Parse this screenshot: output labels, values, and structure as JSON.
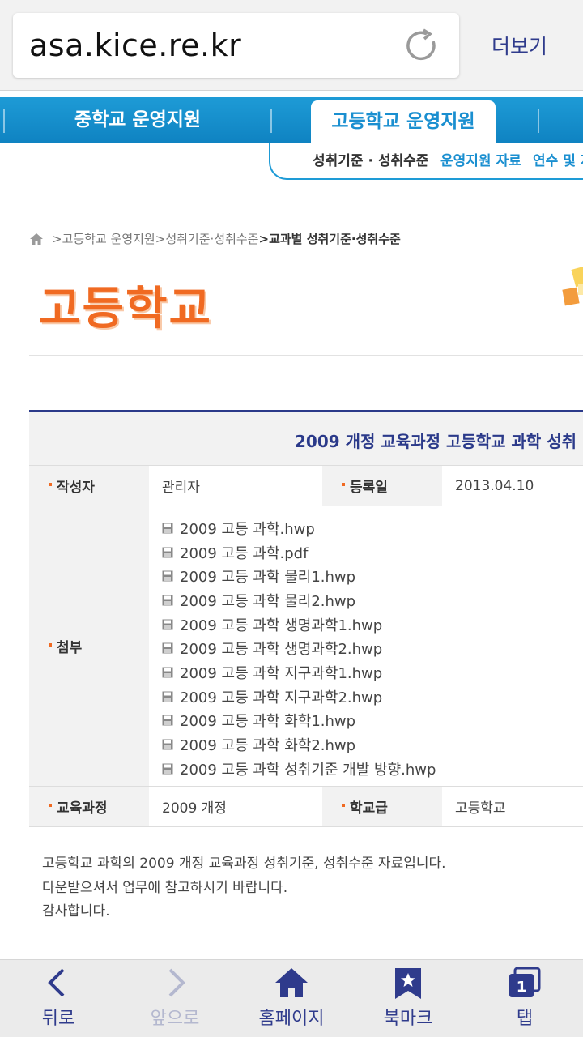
{
  "browser": {
    "url": "asa.kice.re.kr",
    "more_label": "더보기",
    "bottom_nav": {
      "back": "뒤로",
      "forward": "앞으로",
      "home": "홈페이지",
      "bookmark": "북마크",
      "tabs": "탭",
      "tab_count": "1"
    }
  },
  "site_nav": {
    "tabs": [
      "중학교 운영지원",
      "고등학교 운영지원"
    ],
    "active_tab": "고등학교 운영지원",
    "sub_items": [
      "성취기준 · 성취수준",
      "운영지원 자료",
      "연수 및 자"
    ]
  },
  "breadcrumb": {
    "items": [
      ">고등학교 운영지원",
      ">성취기준·성취수준",
      ">교과별 성취기준·성취수준"
    ]
  },
  "page_title": "고등학교",
  "article": {
    "title": "2009 개정 교육과정 고등학교 과학 성취",
    "author_label": "작성자",
    "author": "관리자",
    "date_label": "등록일",
    "date": "2013.04.10",
    "attach_label": "첨부",
    "attachments": [
      "2009 고등 과학.hwp",
      "2009 고등 과학.pdf",
      "2009 고등 과학 물리1.hwp",
      "2009 고등 과학 물리2.hwp",
      "2009 고등 과학 생명과학1.hwp",
      "2009 고등 과학 생명과학2.hwp",
      "2009 고등 과학 지구과학1.hwp",
      "2009 고등 과학 지구과학2.hwp",
      "2009 고등 과학 화학1.hwp",
      "2009 고등 과학 화학2.hwp",
      "2009 고등 과학 성취기준 개발 방향.hwp"
    ],
    "curriculum_label": "교육과정",
    "curriculum": "2009 개정",
    "school_level_label": "학교급",
    "school_level": "고등학교",
    "body": [
      "고등학교 과학의 2009 개정 교육과정 성취기준, 성취수준 자료입니다.",
      "다운받으셔서 업무에 참고하시기 바랍니다.",
      "감사합니다."
    ]
  },
  "colors": {
    "nav_blue": "#1e9bd6",
    "title_orange": "#f06a22",
    "header_navy": "#2b3a8a",
    "browser_text": "#2f3b8c"
  }
}
